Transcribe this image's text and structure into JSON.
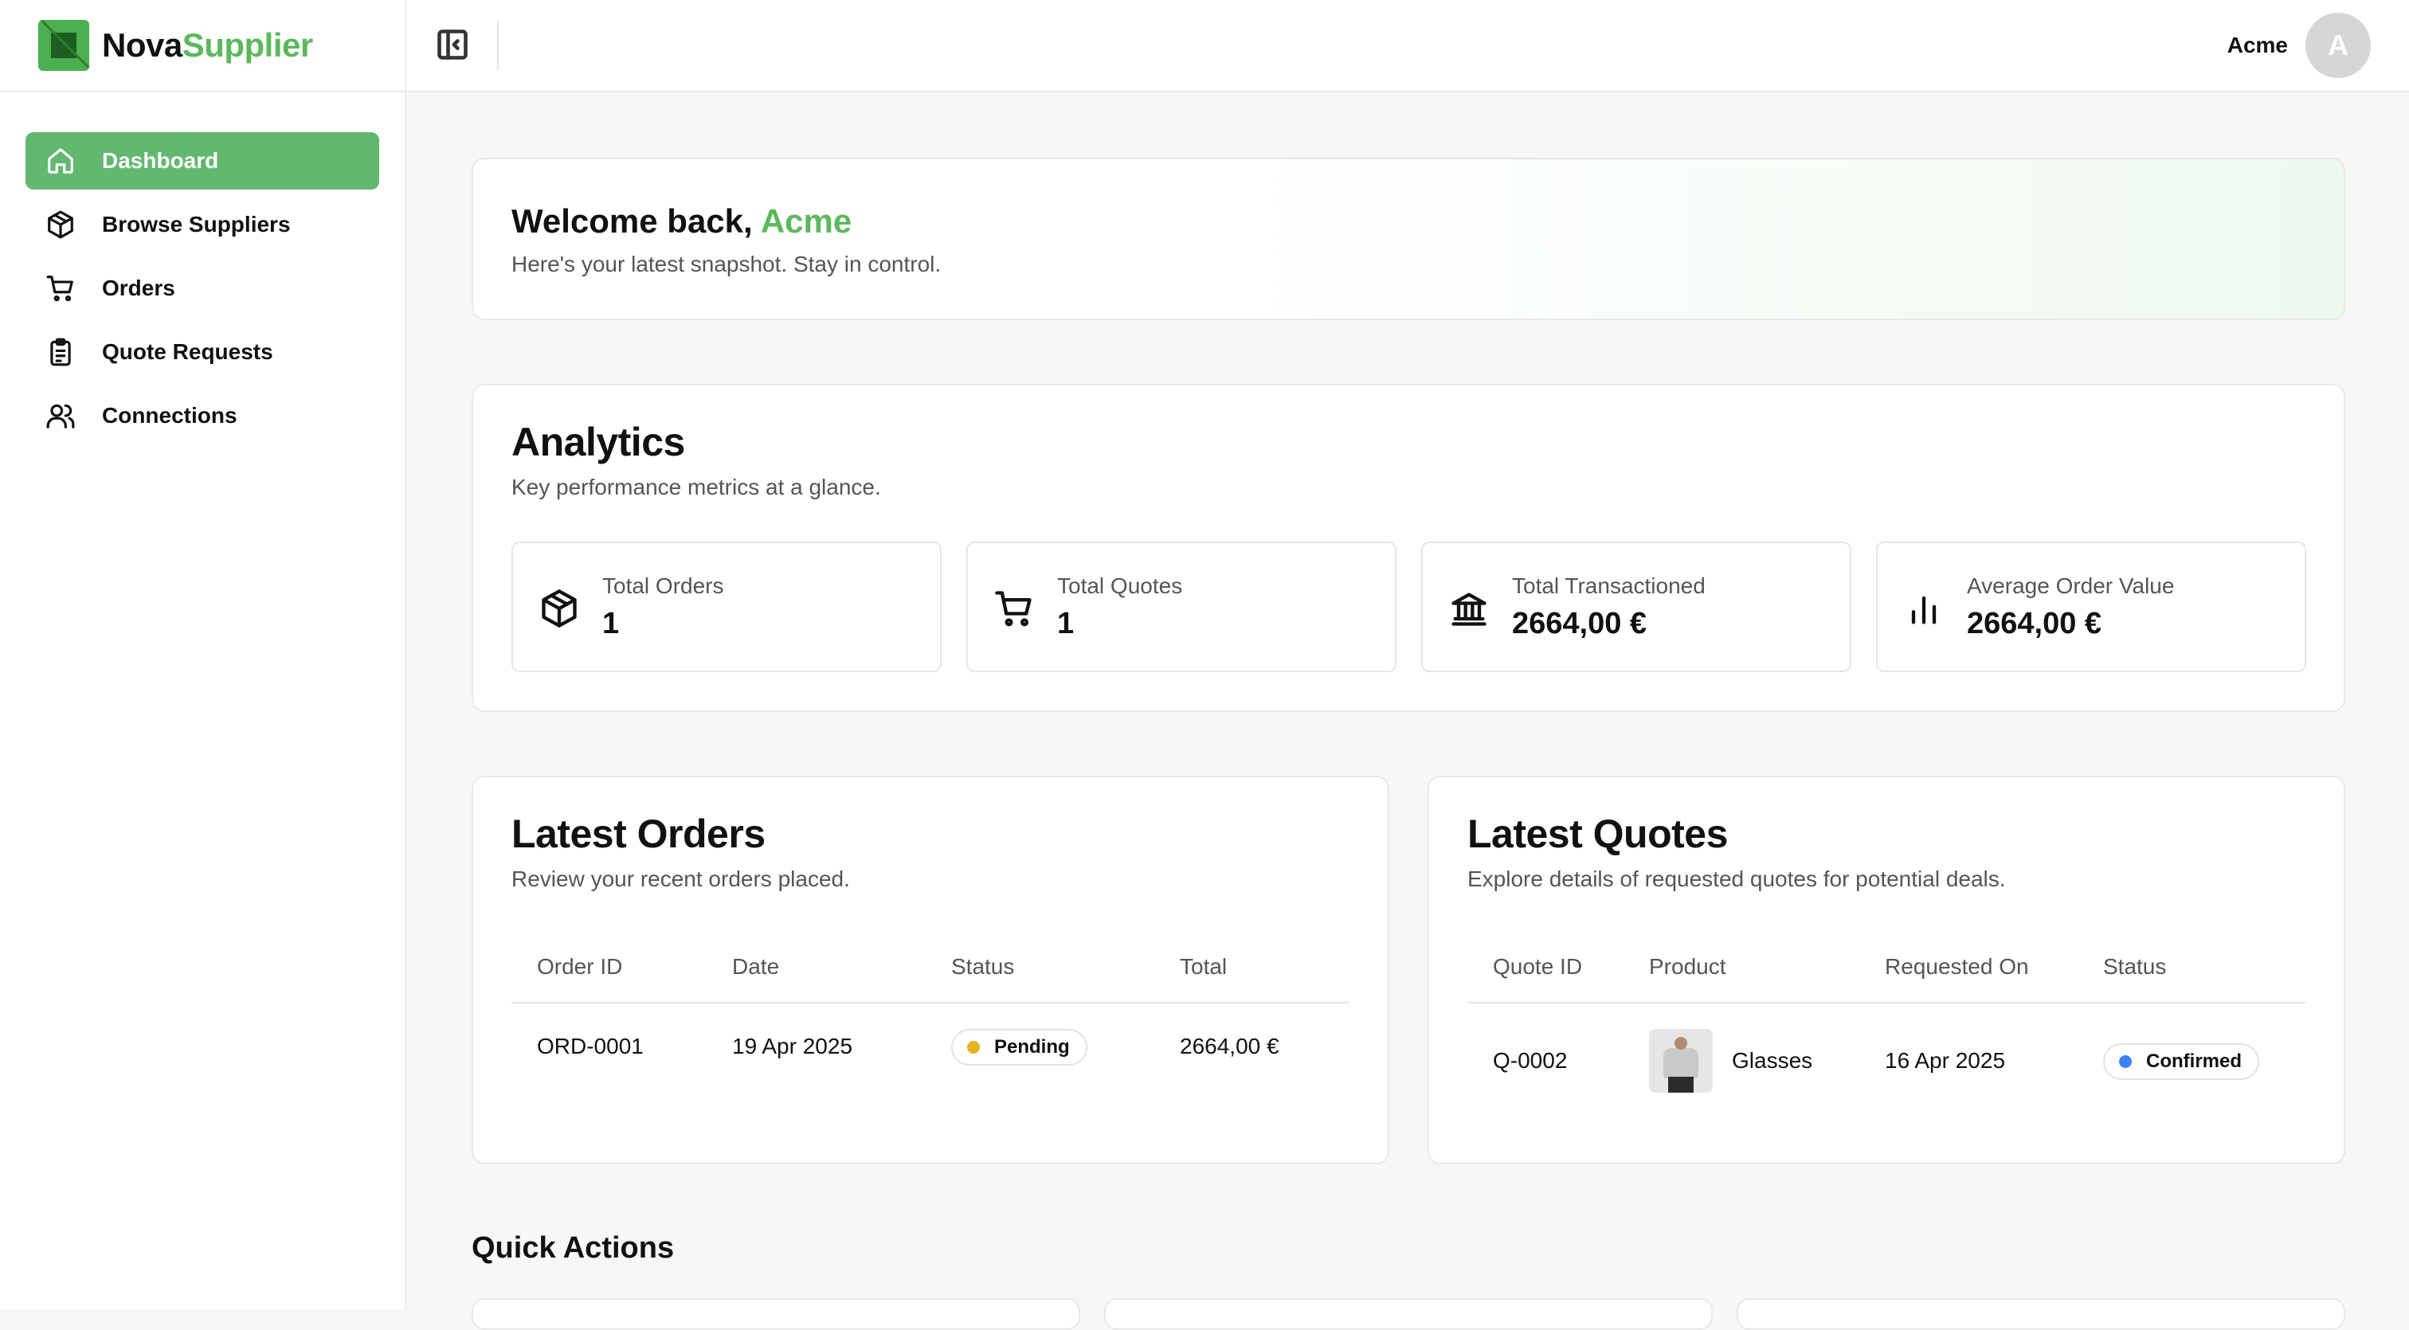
{
  "brand": {
    "name_part1": "Nova",
    "name_part2": "Supplier"
  },
  "sidebar": {
    "items": [
      {
        "label": "Dashboard",
        "icon": "home-icon",
        "active": true
      },
      {
        "label": "Browse Suppliers",
        "icon": "package-icon",
        "active": false
      },
      {
        "label": "Orders",
        "icon": "cart-icon",
        "active": false
      },
      {
        "label": "Quote Requests",
        "icon": "clipboard-icon",
        "active": false
      },
      {
        "label": "Connections",
        "icon": "users-icon",
        "active": false
      }
    ]
  },
  "topbar": {
    "user_name": "Acme",
    "avatar_initial": "A"
  },
  "welcome": {
    "title_prefix": "Welcome back, ",
    "title_name": "Acme",
    "subtitle": "Here's your latest snapshot. Stay in control."
  },
  "analytics": {
    "title": "Analytics",
    "subtitle": "Key performance metrics at a glance.",
    "stats": [
      {
        "label": "Total Orders",
        "value": "1",
        "icon": "package-icon"
      },
      {
        "label": "Total Quotes",
        "value": "1",
        "icon": "cart-icon"
      },
      {
        "label": "Total Transactioned",
        "value": "2664,00 €",
        "icon": "bank-icon"
      },
      {
        "label": "Average Order Value",
        "value": "2664,00 €",
        "icon": "bar-chart-icon"
      }
    ]
  },
  "orders": {
    "title": "Latest Orders",
    "subtitle": "Review your recent orders placed.",
    "columns": [
      "Order ID",
      "Date",
      "Status",
      "Total"
    ],
    "rows": [
      {
        "id": "ORD-0001",
        "date": "19 Apr 2025",
        "status": "Pending",
        "total": "2664,00 €"
      }
    ]
  },
  "quotes": {
    "title": "Latest Quotes",
    "subtitle": "Explore details of requested quotes for potential deals.",
    "columns": [
      "Quote ID",
      "Product",
      "Requested On",
      "Status"
    ],
    "rows": [
      {
        "id": "Q-0002",
        "product": "Glasses",
        "requested_on": "16 Apr 2025",
        "status": "Confirmed"
      }
    ]
  },
  "quick_actions": {
    "title": "Quick Actions"
  },
  "colors": {
    "accent": "#5cb85c",
    "nav_active_bg": "#62b86e",
    "status_pending": "#e6b422",
    "status_confirmed": "#3b82f6"
  }
}
